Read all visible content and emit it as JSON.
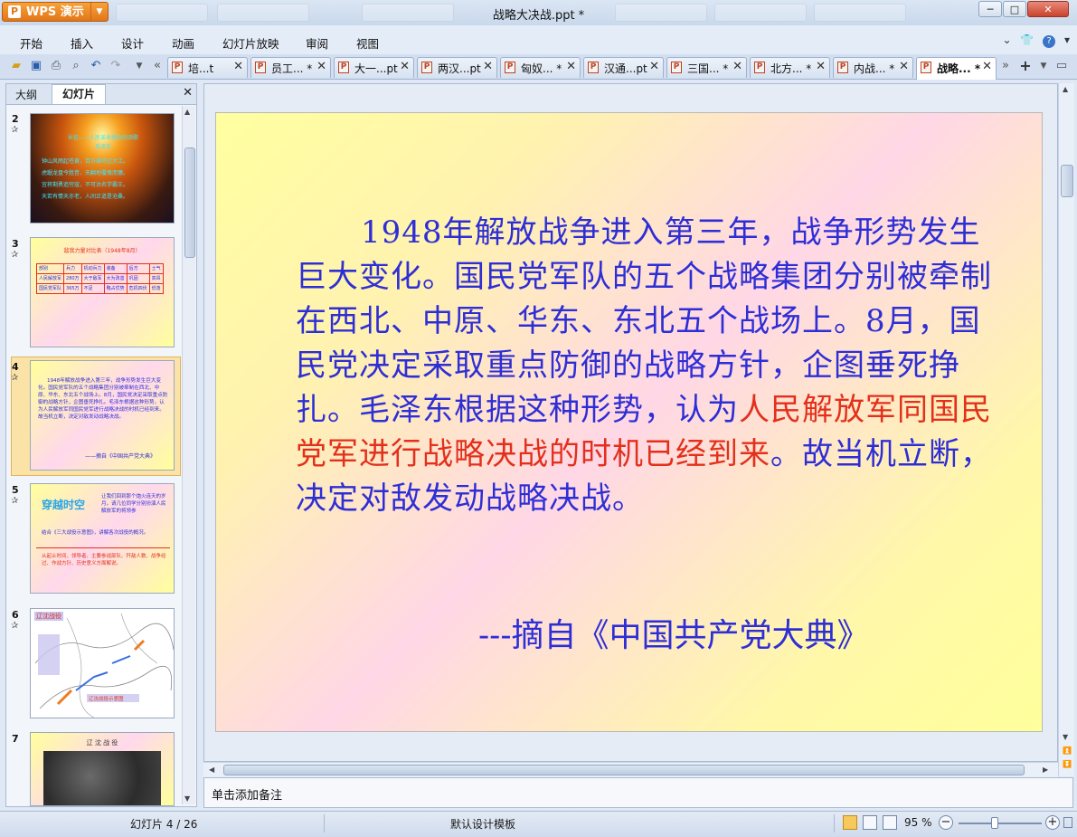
{
  "app": {
    "name": "WPS 演示",
    "logo_text": "P",
    "document_title": "战略大决战.ppt *",
    "window_controls": [
      "─",
      "□",
      "✕"
    ]
  },
  "menu": {
    "tabs": [
      "开始",
      "插入",
      "设计",
      "动画",
      "幻灯片放映",
      "审阅",
      "视图"
    ],
    "right_icons": [
      "chevron-down-icon",
      "shirt-icon",
      "help-icon"
    ]
  },
  "doc_tabs": [
    {
      "label": "培...t"
    },
    {
      "label": "员工... *"
    },
    {
      "label": "大一...pt"
    },
    {
      "label": "两汉...pt"
    },
    {
      "label": "匈奴... *"
    },
    {
      "label": "汉通...pt"
    },
    {
      "label": "三国... *"
    },
    {
      "label": "北方... *"
    },
    {
      "label": "内战... *"
    },
    {
      "label": "战略... *",
      "active": true
    }
  ],
  "left_pane": {
    "tab_outline": "大纲",
    "tab_slides": "幻灯片",
    "close": "✕",
    "thumbs": [
      {
        "num": "2",
        "title": "长征——人民革命理念的颂歌",
        "subtitle": "毛泽东",
        "lines": [
          "钟山风雨起苍黄，百万雄师过大江。",
          "虎踞龙盘今胜昔，天翻地覆慨而慷。",
          "宜将剩勇追穷寇，不可沽名学霸王。",
          "天若有情天亦老，人间正道是沧桑。"
        ]
      },
      {
        "num": "3",
        "title": "敌我力量对比表（1948年8月）",
        "table": [
          [
            "部别",
            "兵力",
            "机动兵力",
            "装备",
            "后方",
            "士气"
          ],
          [
            "人民解放军",
            "280万",
            "大于敌军",
            "大为改善",
            "巩固",
            "高昂"
          ],
          [
            "国民党军队",
            "365万",
            "不足",
            "略占优势",
            "危机四伏",
            "低落"
          ]
        ]
      },
      {
        "num": "4",
        "text": "1948年解放战争进入第三年，战争形势发生巨大变化。国民党军队的五个战略集团分别被牵制在西北、中原、华东、东北五个战场上。8月，国民党决定采取重点防御的战略方针，企图垂死挣扎。毛泽东根据这种形势，认为人民解放军同国民党军进行战略决战的时机已经到来。故当机立断，决定对敌发动战略决战。",
        "source": "——摘自《中国共产党大典》"
      },
      {
        "num": "5",
        "wordart": "穿越时空",
        "text1": "让我们回到那个炮火连天的岁月，请几位同学分别扮演人民解放军的将领参",
        "text2": "结合《三大战役示意图》，讲解各次战役的概况。",
        "text3": "从起止时间、领导者、主要参战部队、歼敌人数、战争经过、作战方针、历史意义方面解说。"
      },
      {
        "num": "6",
        "title": "辽沈战役",
        "caption": "辽沈战役示意图"
      },
      {
        "num": "7",
        "title": "辽 沈 战 役"
      }
    ]
  },
  "slide": {
    "body_before": "1948年解放战争进入第三年，战争形势发生巨大变化。国民党军队的五个战略集团分别被牵制在西北、中原、华东、东北五个战场上。8月，国民党决定采取重点防御的战略方针，企图垂死挣扎。毛泽东根据这种形势，认为",
    "body_highlight": "人民解放军同国民党军进行战略决战的时机已经到来",
    "body_after": "。故当机立断，决定对敌发动战略决战。",
    "source": "---摘自《中国共产党大典》"
  },
  "notes_placeholder": "单击添加备注",
  "status": {
    "slide_counter": "幻灯片 4 / 26",
    "template": "默认设计模板",
    "zoom": "95 %",
    "zoom_level_percent": 95
  },
  "colors": {
    "body_text": "#2e2ed6",
    "highlight_text": "#e3301c",
    "app_button": "#e2761a"
  }
}
